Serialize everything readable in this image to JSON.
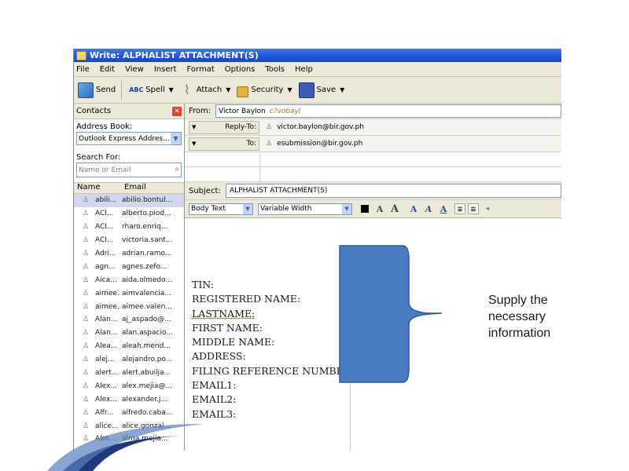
{
  "window": {
    "title": "Write: ALPHALIST ATTACHMENT(S)"
  },
  "menu": [
    "File",
    "Edit",
    "View",
    "Insert",
    "Format",
    "Options",
    "Tools",
    "Help"
  ],
  "toolbar": {
    "send": "Send",
    "spell": "Spell",
    "attach": "Attach",
    "security": "Security",
    "save": "Save"
  },
  "contacts": {
    "title": "Contacts",
    "address_book_label": "Address Book:",
    "address_book_value": "Outlook Express Addres...",
    "search_label": "Search For:",
    "search_placeholder": "Name or Email",
    "col_name": "Name",
    "col_email": "Email",
    "rows": [
      {
        "name": "abili...",
        "email": "abilio.bontul..."
      },
      {
        "name": "ACI...",
        "email": "alberto.piod..."
      },
      {
        "name": "ACI...",
        "email": "rharo.enriq..."
      },
      {
        "name": "ACI...",
        "email": "victoria.sant..."
      },
      {
        "name": "Adri...",
        "email": "adrian.ramo..."
      },
      {
        "name": "agn...",
        "email": "agnes.zefo..."
      },
      {
        "name": "Aica...",
        "email": "aida.olmedo..."
      },
      {
        "name": "aimee...",
        "email": "aimvalencia..."
      },
      {
        "name": "aimee...",
        "email": "aimee.valen..."
      },
      {
        "name": "Alan...",
        "email": "aj_aspado@..."
      },
      {
        "name": "Alan...",
        "email": "alan.aspacio..."
      },
      {
        "name": "Alea...",
        "email": "aleah.mend..."
      },
      {
        "name": "alej...",
        "email": "alejandro.po..."
      },
      {
        "name": "alert...",
        "email": "alert.abuilja..."
      },
      {
        "name": "Alex...",
        "email": "alex.mejia@..."
      },
      {
        "name": "Alex...",
        "email": "alexander.j..."
      },
      {
        "name": "Alfr...",
        "email": "alfredo.caba..."
      },
      {
        "name": "alice...",
        "email": "alice.gonzal..."
      },
      {
        "name": "Alm...",
        "email": "alma.mejia..."
      }
    ]
  },
  "compose": {
    "from_label": "From:",
    "from_name": "Victor Baylon",
    "from_alias": "c?vobayl",
    "reply_to_label": "Reply-To:",
    "reply_to_value": "victor.baylon@bir.gov.ph",
    "to_label": "To:",
    "to_value": "esubmission@bir.gov.ph",
    "subject_label": "Subject:",
    "subject_value": "ALPHALIST ATTACHMENT(S)",
    "format_style": "Body Text",
    "format_font": "Variable Width",
    "body_lines": [
      "TIN:",
      "REGISTERED NAME:",
      "LASTNAME:",
      "FIRST NAME:",
      "MIDDLE NAME:",
      "ADDRESS:",
      "FILING REFERENCE NUMBER:",
      "EMAIL1:",
      "EMAIL2:",
      "EMAIL3:"
    ]
  },
  "annotation": {
    "lines": [
      "Supply the",
      "necessary",
      "information"
    ]
  },
  "colors": {
    "titlebar": "#1f55d8",
    "callout_fill": "#4a7ac0",
    "callout_stroke": "#2d5a96",
    "chrome": "#ece9d8"
  }
}
